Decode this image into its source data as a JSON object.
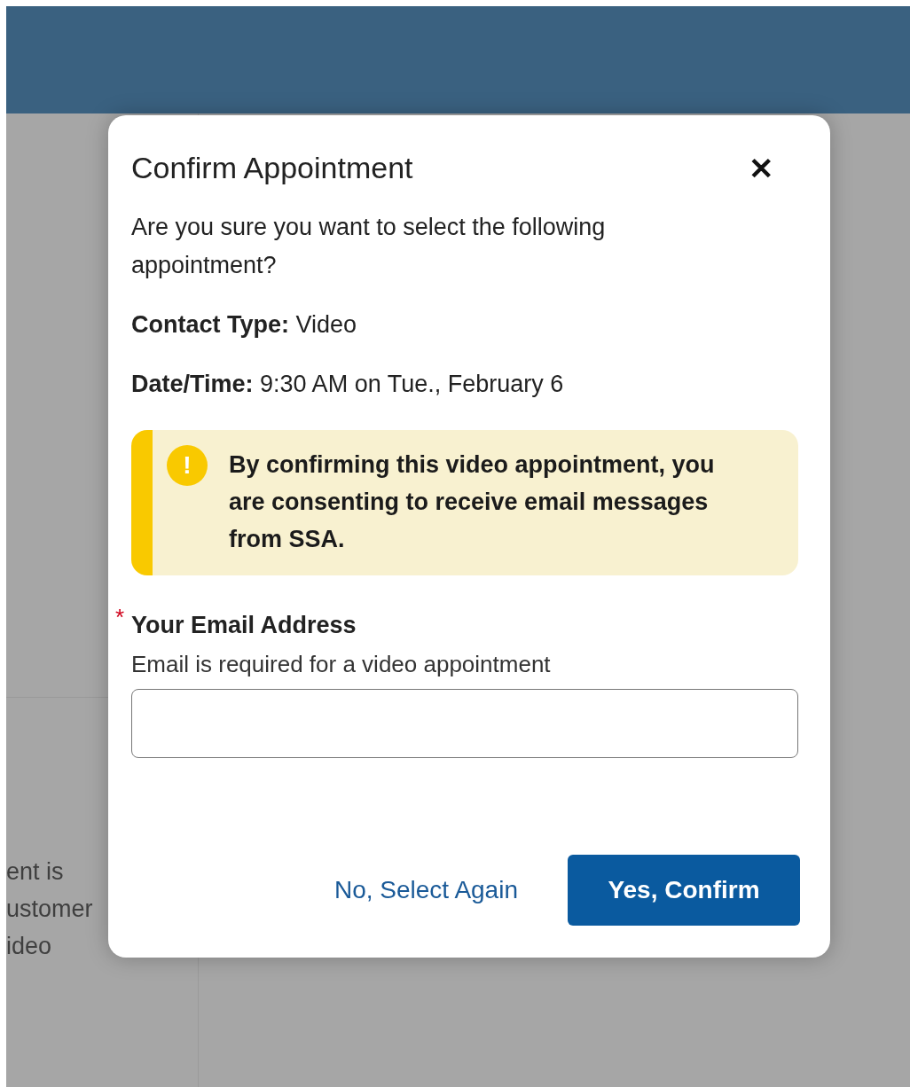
{
  "background": {
    "text_lines": [
      "ent is",
      "ustomer",
      "ideo"
    ]
  },
  "dialog": {
    "title": "Confirm Appointment",
    "close": "✕",
    "intro": "Are you sure you want to select the following appointment?",
    "details": [
      {
        "label": "Contact Type:",
        "value": "Video"
      },
      {
        "label": "Date/Time:",
        "value": "9:30 AM on Tue., February 6"
      }
    ],
    "alert": {
      "icon": "!",
      "text": "By confirming this video appointment, you are consenting to receive email messages from SSA."
    },
    "email": {
      "label": "Your Email Address",
      "required": true,
      "required_mark": "*",
      "hint": "Email is required for a video appointment"
    },
    "buttons": [
      {
        "kind": "link",
        "label": "No, Select Again"
      },
      {
        "kind": "primary",
        "label": "Yes, Confirm"
      }
    ]
  }
}
